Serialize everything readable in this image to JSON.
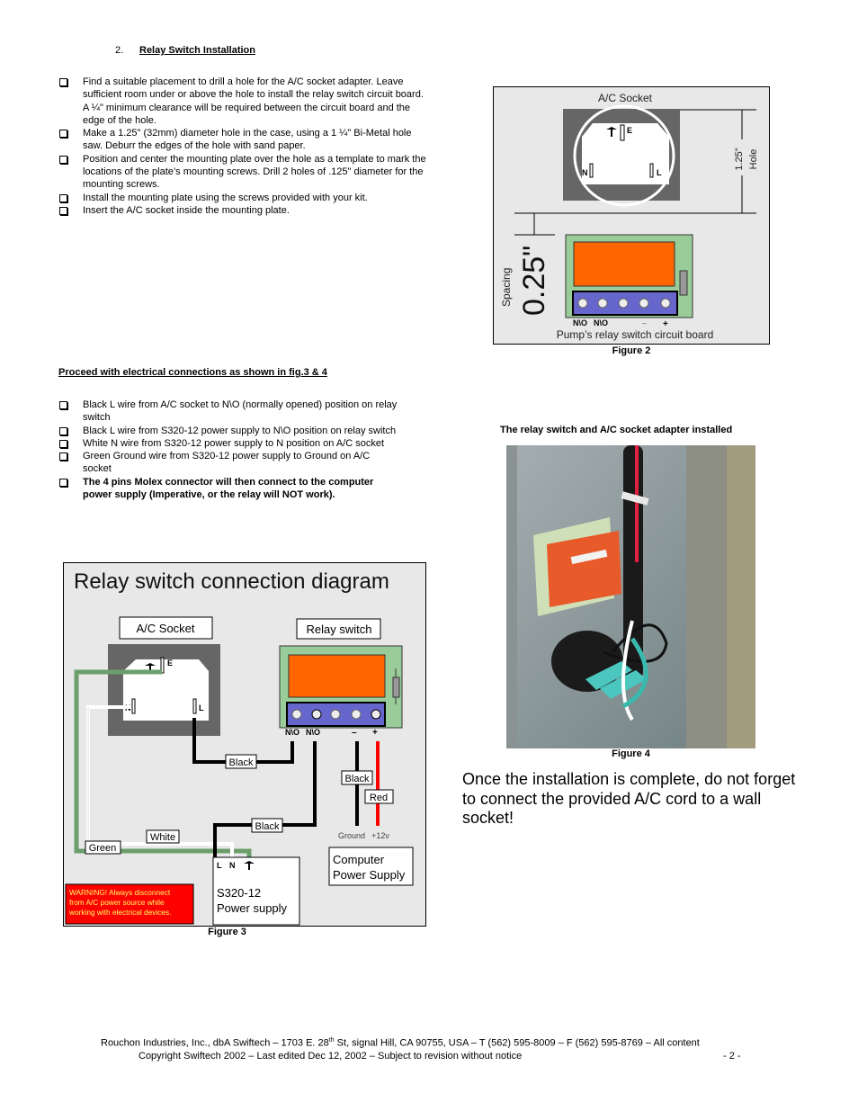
{
  "section": {
    "number": "2.",
    "title": "Relay Switch Installation"
  },
  "install_steps": [
    "Find a suitable placement to drill a hole for the A/C socket adapter. Leave sufficient room under or above the hole to install the relay switch circuit board.  A ¼\" minimum clearance will be required between the circuit board and the edge of the hole.",
    "Make a 1.25\" (32mm) diameter hole in the case, using a 1 ¼\" Bi-Metal hole saw.  Deburr the edges of the hole with sand paper.",
    "Position and center the mounting plate over the hole as a template to mark the locations of the plate’s mounting screws. Drill 2 holes of .125\" diameter for the mounting screws.",
    "Install the mounting plate using the screws provided with your kit.",
    "Insert the A/C socket inside the mounting plate."
  ],
  "proceed_heading": "Proceed with electrical connections as shown in fig.3 & 4",
  "connection_steps": [
    {
      "text": "Black L wire from A/C socket to N\\O (normally opened) position on relay switch",
      "bold": false
    },
    {
      "text": "Black L wire from S320-12 power supply to N\\O position on relay switch",
      "bold": false
    },
    {
      "text": "White N wire from S320-12 power supply to N position on A/C socket",
      "bold": false
    },
    {
      "text": "Green Ground wire from S320-12 power supply to Ground on A/C socket",
      "bold": false
    },
    {
      "text": "The 4 pins Molex connector will then connect to the computer power supply (Imperative, or the relay will NOT work).",
      "bold": true
    }
  ],
  "figure2": {
    "ac_socket_label": "A/C Socket",
    "hole_label_1": "1.25\"",
    "hole_label_2": "Hole",
    "spacing_value": "0.25\"",
    "spacing_label": "Spacing",
    "terminal_labels": [
      "N\\O",
      "N\\O",
      "–",
      "+"
    ],
    "board_label": "Pump’s relay switch circuit board",
    "pin_e": "E",
    "pin_n": "N",
    "pin_l": "L",
    "caption": "Figure 2"
  },
  "figure3": {
    "title": "Relay  switch connection diagram",
    "ac_socket_label": "A/C Socket",
    "relay_label": "Relay switch",
    "pin_e": "E",
    "pin_n": "N",
    "pin_l": "L",
    "terminal_labels": [
      "N\\O",
      "N\\O",
      "–",
      "+"
    ],
    "wire_labels": {
      "black_1": "Black",
      "black_2": "Black",
      "black_3": "Black",
      "red": "Red",
      "white": "White",
      "green": "Green"
    },
    "ground_label": "Ground",
    "v12_label": "+12v",
    "psu_pins": [
      "L",
      "N"
    ],
    "psu_name_1": "S320-12",
    "psu_name_2": "Power supply",
    "computer_psu_1": "Computer",
    "computer_psu_2": "Power Supply",
    "warning": "WARNING! Always disconnect from A/C power source while working with electrical devices.",
    "caption": "Figure 3",
    "colors": {
      "green_wire": "#6b9e6b",
      "red_wire": "#ff0000",
      "relay_orange": "#ff6600",
      "relay_board": "#99cc99",
      "terminal_block": "#6666cc",
      "socket_frame": "#666666",
      "warning_bg": "#ff0000",
      "warning_text": "#ffff66"
    }
  },
  "photo": {
    "title": "The relay switch and A/C socket adapter installed",
    "caption": "Figure 4"
  },
  "closing_note": "Once the installation is complete, do not forget to connect the provided A/C cord to a wall socket!",
  "footer": {
    "line1_a": "Rouchon Industries, Inc., dbA Swiftech – 1703 E. 28",
    "line1_sup": "th",
    "line1_b": " St, signal Hill, CA 90755, USA – T (562) 595-8009 – F (562) 595-8769 – All content",
    "line2": "Copyright Swiftech 2002 – Last edited Dec 12, 2002 – Subject to revision without notice",
    "page": "- 2 -"
  }
}
